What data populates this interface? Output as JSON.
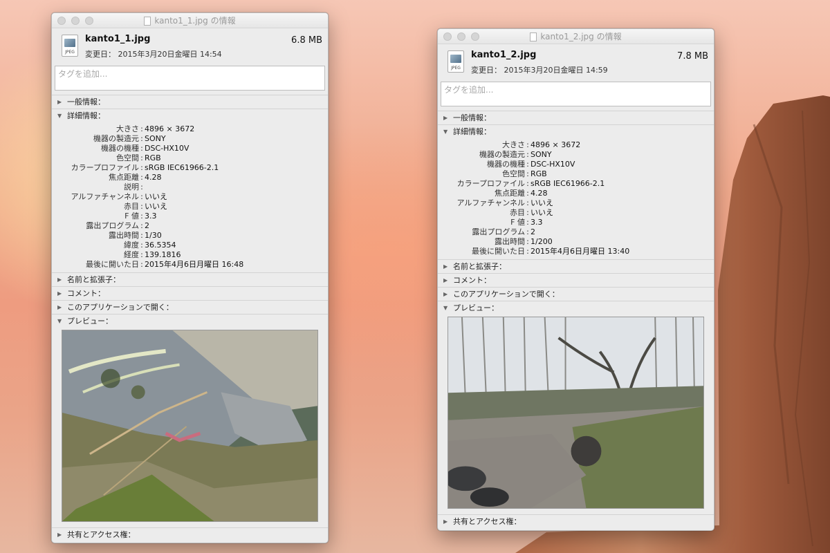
{
  "windows": [
    {
      "title": "kanto1_1.jpg の情報",
      "file_name": "kanto1_1.jpg",
      "file_size": "6.8 MB",
      "modified": "変更日： 2015年3月20日金曜日 14:54",
      "tag_placeholder": "タグを追加...",
      "icon_label": "JPEG",
      "sections": {
        "general": "一般情報：",
        "more_info": "詳細情報：",
        "name_ext": "名前と拡張子：",
        "comments": "コメント：",
        "open_with": "このアプリケーションで開く：",
        "preview": "プレビュー：",
        "sharing": "共有とアクセス権："
      },
      "details": [
        {
          "k": "大きさ",
          "v": "4896 × 3672"
        },
        {
          "k": "機器の製造元",
          "v": "SONY"
        },
        {
          "k": "機器の機種",
          "v": "DSC-HX10V"
        },
        {
          "k": "色空間",
          "v": "RGB"
        },
        {
          "k": "カラープロファイル",
          "v": "sRGB IEC61966-2.1"
        },
        {
          "k": "焦点距離",
          "v": "4.28"
        },
        {
          "k": "説明",
          "v": ""
        },
        {
          "k": "アルファチャンネル",
          "v": "いいえ"
        },
        {
          "k": "赤目",
          "v": "いいえ"
        },
        {
          "k": "F 値",
          "v": "3.3"
        },
        {
          "k": "露出プログラム",
          "v": "2"
        },
        {
          "k": "露出時間",
          "v": "1/30"
        },
        {
          "k": "緯度",
          "v": "36.5354"
        },
        {
          "k": "経度",
          "v": "139.1816"
        },
        {
          "k": "最後に開いた日",
          "v": "2015年4月6日月曜日 16:48"
        }
      ]
    },
    {
      "title": "kanto1_2.jpg の情報",
      "file_name": "kanto1_2.jpg",
      "file_size": "7.8 MB",
      "modified": "変更日： 2015年3月20日金曜日 14:59",
      "tag_placeholder": "タグを追加...",
      "icon_label": "JPEG",
      "sections": {
        "general": "一般情報：",
        "more_info": "詳細情報：",
        "name_ext": "名前と拡張子：",
        "comments": "コメント：",
        "open_with": "このアプリケーションで開く：",
        "preview": "プレビュー：",
        "sharing": "共有とアクセス権："
      },
      "details": [
        {
          "k": "大きさ",
          "v": "4896 × 3672"
        },
        {
          "k": "機器の製造元",
          "v": "SONY"
        },
        {
          "k": "機器の機種",
          "v": "DSC-HX10V"
        },
        {
          "k": "色空間",
          "v": "RGB"
        },
        {
          "k": "カラープロファイル",
          "v": "sRGB IEC61966-2.1"
        },
        {
          "k": "焦点距離",
          "v": "4.28"
        },
        {
          "k": "アルファチャンネル",
          "v": "いいえ"
        },
        {
          "k": "赤目",
          "v": "いいえ"
        },
        {
          "k": "F 値",
          "v": "3.3"
        },
        {
          "k": "露出プログラム",
          "v": "2"
        },
        {
          "k": "露出時間",
          "v": "1/200"
        },
        {
          "k": "最後に開いた日",
          "v": "2015年4月6日月曜日 13:40"
        }
      ]
    }
  ]
}
